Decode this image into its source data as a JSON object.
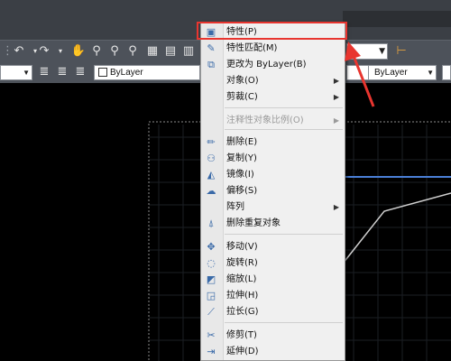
{
  "toolbar": {
    "color_combo": "ByLayer",
    "linetype_combo": "ByLayer",
    "lineweight_combo": "ByLayer"
  },
  "menu": {
    "items": [
      {
        "label": "特性(P)",
        "icon": "properties-icon",
        "enabled": true
      },
      {
        "label": "特性匹配(M)",
        "icon": "match-properties-icon",
        "enabled": true
      },
      {
        "label": "更改为 ByLayer(B)",
        "icon": "change-bylayer-icon",
        "enabled": true
      },
      {
        "label": "对象(O)",
        "icon": "",
        "enabled": true,
        "submenu": true
      },
      {
        "label": "剪裁(C)",
        "icon": "",
        "enabled": true,
        "submenu": true
      },
      {
        "label": "注释性对象比例(O)",
        "icon": "",
        "enabled": false,
        "submenu": true
      },
      {
        "label": "删除(E)",
        "icon": "erase-icon",
        "enabled": true
      },
      {
        "label": "复制(Y)",
        "icon": "copy-icon",
        "enabled": true
      },
      {
        "label": "镜像(I)",
        "icon": "mirror-icon",
        "enabled": true
      },
      {
        "label": "偏移(S)",
        "icon": "offset-icon",
        "enabled": true
      },
      {
        "label": "阵列",
        "icon": "",
        "enabled": true,
        "submenu": true
      },
      {
        "label": "删除重复对象",
        "icon": "overkill-icon",
        "enabled": true
      },
      {
        "label": "移动(V)",
        "icon": "move-icon",
        "enabled": true
      },
      {
        "label": "旋转(R)",
        "icon": "rotate-icon",
        "enabled": true
      },
      {
        "label": "缩放(L)",
        "icon": "scale-icon",
        "enabled": true
      },
      {
        "label": "拉伸(H)",
        "icon": "stretch-icon",
        "enabled": true
      },
      {
        "label": "拉长(G)",
        "icon": "lengthen-icon",
        "enabled": true
      },
      {
        "label": "修剪(T)",
        "icon": "trim-icon",
        "enabled": true
      },
      {
        "label": "延伸(D)",
        "icon": "extend-icon",
        "enabled": true
      }
    ]
  },
  "colors": {
    "highlight": "#e8352f",
    "selection_line": "#4a7fd6",
    "arrow": "#e8352f"
  }
}
